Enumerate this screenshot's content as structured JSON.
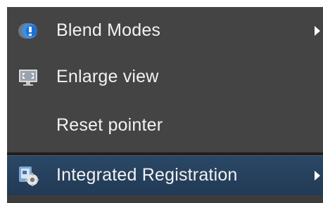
{
  "menu": {
    "items": [
      {
        "label": "Blend Modes",
        "icon": "blend-modes-icon",
        "has_submenu": true,
        "highlighted": false
      },
      {
        "label": "Enlarge view",
        "icon": "enlarge-view-icon",
        "has_submenu": false,
        "highlighted": false
      },
      {
        "label": "Reset pointer",
        "icon": "",
        "has_submenu": false,
        "highlighted": false
      },
      {
        "label": "Integrated Registration",
        "icon": "integrated-registration-icon",
        "has_submenu": true,
        "highlighted": true
      }
    ]
  },
  "colors": {
    "menu_background": "#444444",
    "highlight_background": "#2a4866",
    "text": "#f2f2f2",
    "separator": "#1e1e1e"
  }
}
